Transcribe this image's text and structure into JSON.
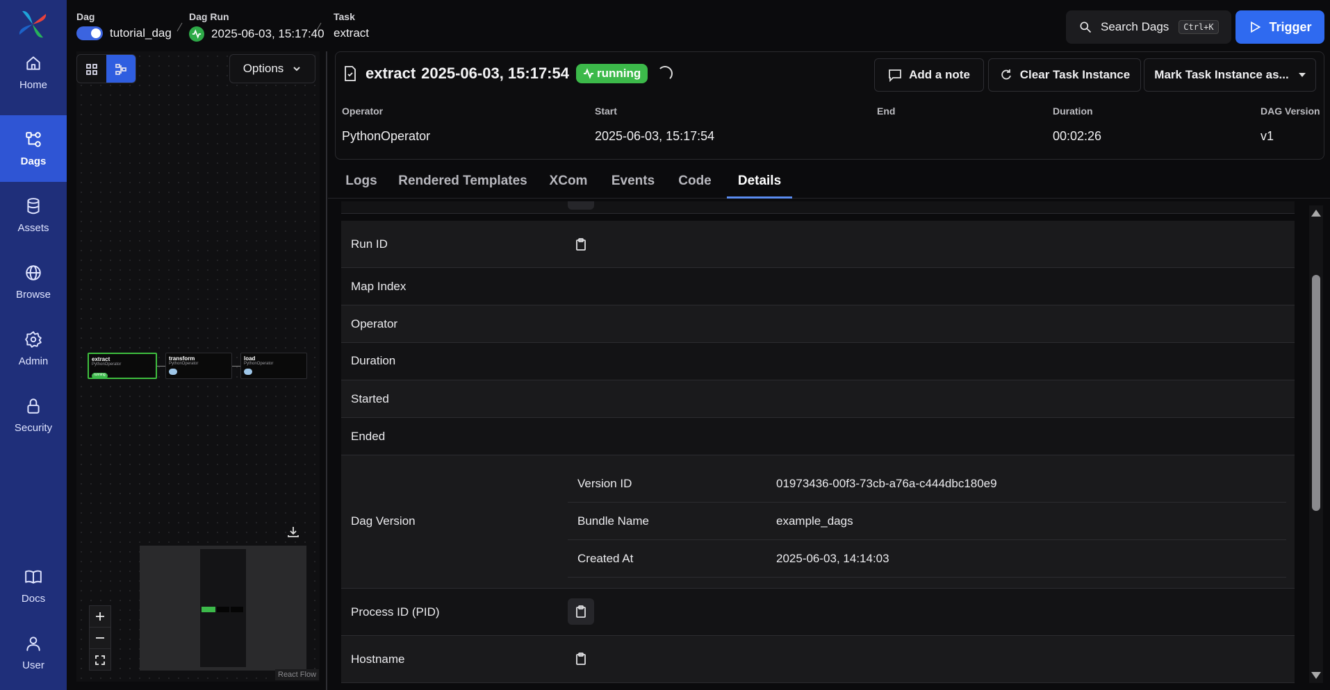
{
  "nav": {
    "items": [
      {
        "label": "Home",
        "icon": "home-icon"
      },
      {
        "label": "Dags",
        "icon": "dags-icon"
      },
      {
        "label": "Assets",
        "icon": "assets-icon"
      },
      {
        "label": "Browse",
        "icon": "globe-icon"
      },
      {
        "label": "Admin",
        "icon": "gear-icon"
      },
      {
        "label": "Security",
        "icon": "lock-icon"
      },
      {
        "label": "Docs",
        "icon": "book-icon"
      },
      {
        "label": "User",
        "icon": "user-icon"
      }
    ],
    "active": "Dags"
  },
  "breadcrumb": {
    "dag_label": "Dag",
    "dag_value": "tutorial_dag",
    "run_label": "Dag Run",
    "run_value": "2025-06-03, 15:17:40",
    "task_label": "Task",
    "task_value": "extract"
  },
  "header": {
    "search_label": "Search Dags",
    "search_shortcut": "Ctrl+K",
    "trigger_label": "Trigger"
  },
  "graph": {
    "options_label": "Options",
    "nodes": [
      {
        "name": "extract",
        "operator": "PythonOperator",
        "state": "running"
      },
      {
        "name": "transform",
        "operator": "PythonOperator",
        "state": ""
      },
      {
        "name": "load",
        "operator": "PythonOperator",
        "state": ""
      }
    ],
    "attribution": "React Flow"
  },
  "task": {
    "title_name": "extract",
    "title_time": "2025-06-03, 15:17:54",
    "state": "running",
    "add_note_label": "Add a note",
    "clear_label": "Clear Task Instance",
    "mark_label": "Mark Task Instance as...",
    "meta": {
      "operator_label": "Operator",
      "operator_value": "PythonOperator",
      "start_label": "Start",
      "start_value": "2025-06-03, 15:17:54",
      "end_label": "End",
      "end_value": "",
      "duration_label": "Duration",
      "duration_value": "00:02:26",
      "version_label": "DAG Version",
      "version_value": "v1"
    }
  },
  "tabs": [
    "Logs",
    "Rendered Templates",
    "XCom",
    "Events",
    "Code",
    "Details"
  ],
  "active_tab": "Details",
  "details": {
    "run_id": "Run ID",
    "map_index": "Map Index",
    "operator": "Operator",
    "duration": "Duration",
    "started": "Started",
    "ended": "Ended",
    "dag_version": "Dag Version",
    "version": {
      "version_id_label": "Version ID",
      "version_id_value": "01973436-00f3-73cb-a76a-c444dbc180e9",
      "bundle_label": "Bundle Name",
      "bundle_value": "example_dags",
      "created_label": "Created At",
      "created_value": "2025-06-03, 14:14:03"
    },
    "pid": "Process ID (PID)",
    "hostname": "Hostname"
  },
  "colors": {
    "sidebar": "#1f2f7a",
    "sidebar_active": "#2f55d4",
    "accent": "#2f6af0",
    "running": "#3cb94a"
  }
}
